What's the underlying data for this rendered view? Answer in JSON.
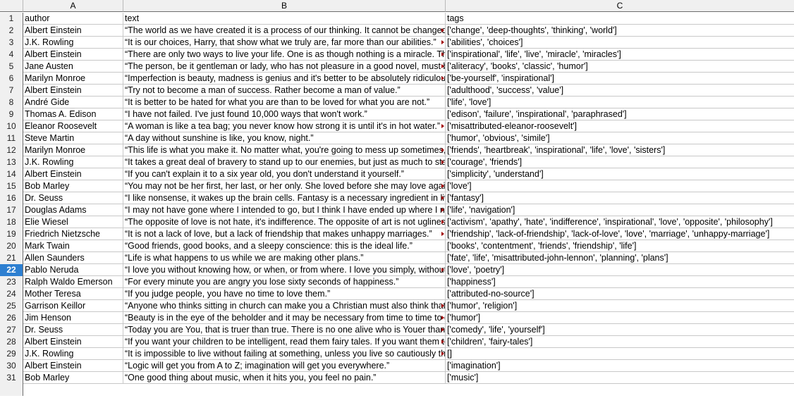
{
  "columns": [
    "A",
    "B",
    "C"
  ],
  "selected_row": 22,
  "rows": [
    {
      "n": "1",
      "author": "author",
      "text": "text",
      "tags": "tags",
      "overflow": false
    },
    {
      "n": "2",
      "author": "Albert Einstein",
      "text": "“The world as we have created it is a process of our thinking. It cannot be changed without changing our thinking.”",
      "tags": "['change', 'deep-thoughts', 'thinking', 'world']",
      "overflow": true
    },
    {
      "n": "3",
      "author": "J.K. Rowling",
      "text": "“It is our choices, Harry, that show what we truly are, far more than our abilities.”",
      "tags": "['abilities', 'choices']",
      "overflow": true
    },
    {
      "n": "4",
      "author": "Albert Einstein",
      "text": "“There are only two ways to live your life. One is as though nothing is a miracle. The other is as though everything is a miracle.”",
      "tags": "['inspirational', 'life', 'live', 'miracle', 'miracles']",
      "overflow": true
    },
    {
      "n": "5",
      "author": "Jane Austen",
      "text": "“The person, be it gentleman or lady, who has not pleasure in a good novel, must be intolerably stupid.”",
      "tags": "['aliteracy', 'books', 'classic', 'humor']",
      "overflow": true
    },
    {
      "n": "6",
      "author": "Marilyn Monroe",
      "text": "“Imperfection is beauty, madness is genius and it's better to be absolutely ridiculous than absolutely boring.”",
      "tags": "['be-yourself', 'inspirational']",
      "overflow": true
    },
    {
      "n": "7",
      "author": "Albert Einstein",
      "text": "“Try not to become a man of success. Rather become a man of value.”",
      "tags": "['adulthood', 'success', 'value']",
      "overflow": false
    },
    {
      "n": "8",
      "author": "André Gide",
      "text": "“It is better to be hated for what you are than to be loved for what you are not.”",
      "tags": "['life', 'love']",
      "overflow": false
    },
    {
      "n": "9",
      "author": "Thomas A. Edison",
      "text": "“I have not failed. I've just found 10,000 ways that won't work.”",
      "tags": "['edison', 'failure', 'inspirational', 'paraphrased']",
      "overflow": false
    },
    {
      "n": "10",
      "author": "Eleanor Roosevelt",
      "text": "“A woman is like a tea bag; you never know how strong it is until it's in hot water.”",
      "tags": "['misattributed-eleanor-roosevelt']",
      "overflow": true
    },
    {
      "n": "11",
      "author": "Steve Martin",
      "text": "“A day without sunshine is like, you know, night.”",
      "tags": "['humor', 'obvious', 'simile']",
      "overflow": false
    },
    {
      "n": "12",
      "author": "Marilyn Monroe",
      "text": "“This life is what you make it. No matter what, you're going to mess up sometimes, it's a universal truth.”",
      "tags": "['friends', 'heartbreak', 'inspirational', 'life', 'love', 'sisters']",
      "overflow": true
    },
    {
      "n": "13",
      "author": "J.K. Rowling",
      "text": "“It takes a great deal of bravery to stand up to our enemies, but just as much to stand up to our friends.”",
      "tags": "['courage', 'friends']",
      "overflow": true
    },
    {
      "n": "14",
      "author": "Albert Einstein",
      "text": "“If you can't explain it to a six year old, you don't understand it yourself.”",
      "tags": "['simplicity', 'understand']",
      "overflow": false
    },
    {
      "n": "15",
      "author": "Bob Marley",
      "text": "“You may not be her first, her last, or her only. She loved before she may love again.”",
      "tags": "['love']",
      "overflow": true
    },
    {
      "n": "16",
      "author": "Dr. Seuss",
      "text": "“I like nonsense, it wakes up the brain cells. Fantasy is a necessary ingredient in living.”",
      "tags": "['fantasy']",
      "overflow": true
    },
    {
      "n": "17",
      "author": "Douglas Adams",
      "text": "“I may not have gone where I intended to go, but I think I have ended up where I needed to be.”",
      "tags": "['life', 'navigation']",
      "overflow": true
    },
    {
      "n": "18",
      "author": "Elie Wiesel",
      "text": "“The opposite of love is not hate, it's indifference. The opposite of art is not ugliness, it's indifference.”",
      "tags": "['activism', 'apathy', 'hate', 'indifference', 'inspirational', 'love', 'opposite', 'philosophy']",
      "overflow": true
    },
    {
      "n": "19",
      "author": "Friedrich Nietzsche",
      "text": "“It is not a lack of love, but a lack of friendship that makes unhappy marriages.”",
      "tags": "['friendship', 'lack-of-friendship', 'lack-of-love', 'love', 'marriage', 'unhappy-marriage']",
      "overflow": true
    },
    {
      "n": "20",
      "author": "Mark Twain",
      "text": "“Good friends, good books, and a sleepy conscience: this is the ideal life.”",
      "tags": "['books', 'contentment', 'friends', 'friendship', 'life']",
      "overflow": false
    },
    {
      "n": "21",
      "author": "Allen Saunders",
      "text": "“Life is what happens to us while we are making other plans.”",
      "tags": "['fate', 'life', 'misattributed-john-lennon', 'planning', 'plans']",
      "overflow": false
    },
    {
      "n": "22",
      "author": "Pablo Neruda",
      "text": "“I love you without knowing how, or when, or from where. I love you simply, without problems or pride.”",
      "tags": "['love', 'poetry']",
      "overflow": true
    },
    {
      "n": "23",
      "author": "Ralph Waldo Emerson",
      "text": "“For every minute you are angry you lose sixty seconds of happiness.”",
      "tags": "['happiness']",
      "overflow": false
    },
    {
      "n": "24",
      "author": "Mother Teresa",
      "text": "“If you judge people, you have no time to love them.”",
      "tags": "['attributed-no-source']",
      "overflow": false
    },
    {
      "n": "25",
      "author": "Garrison Keillor",
      "text": "“Anyone who thinks sitting in church can make you a Christian must also think that sitting in a garage can make you a car.”",
      "tags": "['humor', 'religion']",
      "overflow": true
    },
    {
      "n": "26",
      "author": "Jim Henson",
      "text": "“Beauty is in the eye of the beholder and it may be necessary from time to time to give a stupid or misinformed beholder a black eye.”",
      "tags": "['humor']",
      "overflow": true
    },
    {
      "n": "27",
      "author": "Dr. Seuss",
      "text": "“Today you are You, that is truer than true. There is no one alive who is Youer than You.”",
      "tags": "['comedy', 'life', 'yourself']",
      "overflow": true
    },
    {
      "n": "28",
      "author": "Albert Einstein",
      "text": "“If you want your children to be intelligent, read them fairy tales. If you want them to be more intelligent, read them more fairy tales.”",
      "tags": "['children', 'fairy-tales']",
      "overflow": true
    },
    {
      "n": "29",
      "author": "J.K. Rowling",
      "text": "“It is impossible to live without failing at something, unless you live so cautiously that you might as well not have lived at all.”",
      "tags": "[]",
      "overflow": true
    },
    {
      "n": "30",
      "author": "Albert Einstein",
      "text": "“Logic will get you from A to Z; imagination will get you everywhere.”",
      "tags": "['imagination']",
      "overflow": false
    },
    {
      "n": "31",
      "author": "Bob Marley",
      "text": "“One good thing about music, when it hits you, you feel no pain.”",
      "tags": "['music']",
      "overflow": false
    }
  ]
}
